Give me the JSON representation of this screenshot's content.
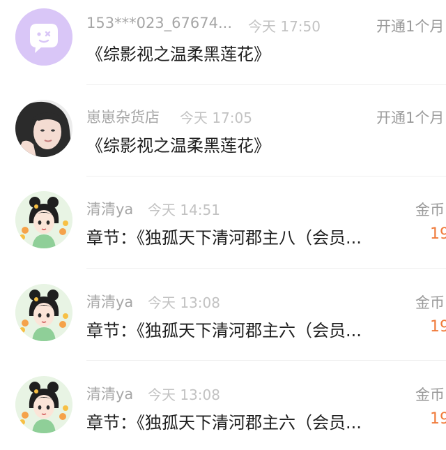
{
  "messages": [
    {
      "name": "153***023_67674...",
      "time": "今天 17:50",
      "content": "《综影视之温柔黑莲花》",
      "right_label": "开通1个月",
      "amount": "",
      "avatar": "default-chat-icon",
      "avatar_color": "#d9c6f7"
    },
    {
      "name": "崽崽杂货店",
      "time": "今天 17:05",
      "content": "《综影视之温柔黑莲花》",
      "right_label": "开通1个月",
      "amount": "",
      "avatar": "girl-photo-avatar",
      "avatar_color": "#e8e8e8"
    },
    {
      "name": "清清ya",
      "time": "今天 14:51",
      "content": "章节：《独孤天下清河郡主八（会员...",
      "right_label": "金币",
      "amount": "19",
      "avatar": "cartoon-girl-avatar",
      "avatar_color": "#e8f4e4"
    },
    {
      "name": "清清ya",
      "time": "今天 13:08",
      "content": "章节：《独孤天下清河郡主六（会员...",
      "right_label": "金币",
      "amount": "19",
      "avatar": "cartoon-girl-avatar",
      "avatar_color": "#e8f4e4"
    },
    {
      "name": "清清ya",
      "time": "今天 13:08",
      "content": "章节：《独孤天下清河郡主六（会员...",
      "right_label": "金币",
      "amount": "19",
      "avatar": "cartoon-girl-avatar",
      "avatar_color": "#e8f4e4"
    }
  ],
  "colors": {
    "name": "#a6a6a6",
    "time": "#c2c2c2",
    "content": "#1e1e1e",
    "amount": "#f07a3a",
    "divider": "#efefef"
  }
}
